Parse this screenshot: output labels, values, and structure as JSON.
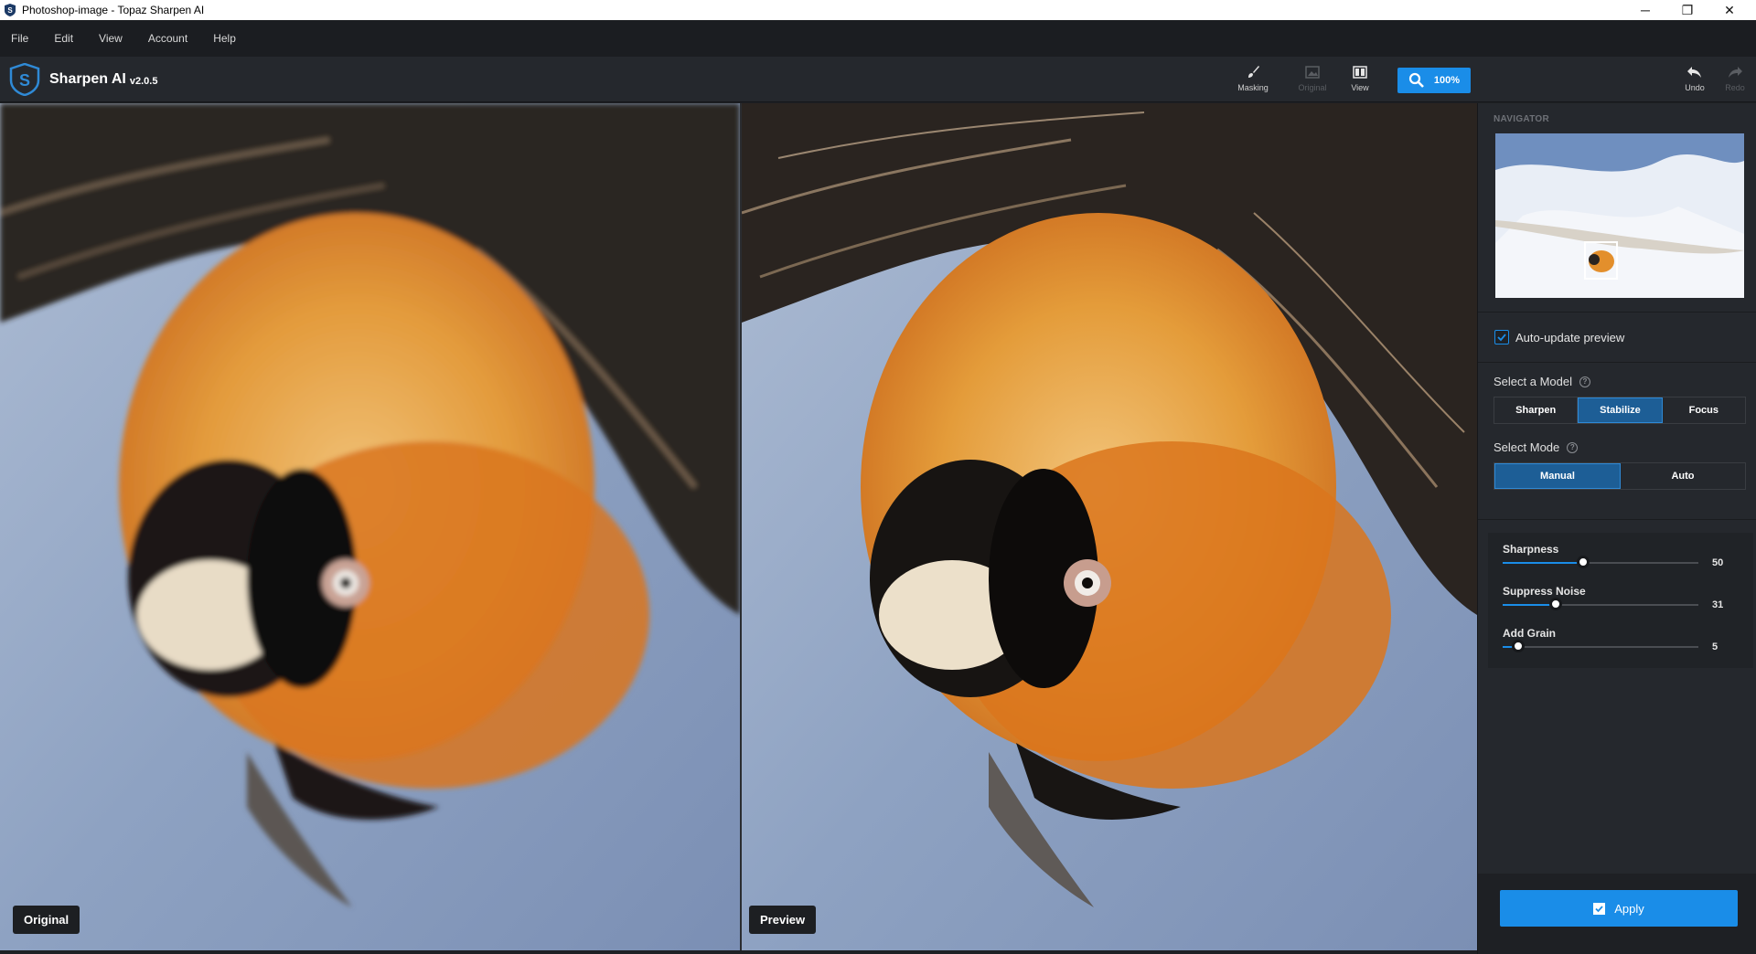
{
  "window": {
    "title": "Photoshop-image - Topaz Sharpen AI",
    "minimize_glyph": "─",
    "restore_glyph": "❐",
    "close_glyph": "✕"
  },
  "menu": {
    "items": [
      {
        "label": "File"
      },
      {
        "label": "Edit"
      },
      {
        "label": "View"
      },
      {
        "label": "Account"
      },
      {
        "label": "Help"
      }
    ]
  },
  "toolbar": {
    "app_name": "Sharpen AI",
    "version": "v2.0.5",
    "masking_label": "Masking",
    "original_label": "Original",
    "view_label": "View",
    "zoom_label": "100%",
    "undo_label": "Undo",
    "redo_label": "Redo"
  },
  "canvas": {
    "left_tag": "Original",
    "right_tag": "Preview"
  },
  "sidebar": {
    "navigator_label": "NAVIGATOR",
    "auto_update": {
      "label": "Auto-update preview",
      "checked": true
    },
    "model": {
      "heading": "Select a Model",
      "help": "?",
      "options": [
        "Sharpen",
        "Stabilize",
        "Focus"
      ],
      "selected": "Stabilize"
    },
    "mode": {
      "heading": "Select Mode",
      "help": "?",
      "options": [
        "Manual",
        "Auto"
      ],
      "selected": "Manual"
    },
    "sliders": [
      {
        "label": "Sharpness",
        "value": "50",
        "fraction": 0.41
      },
      {
        "label": "Suppress Noise",
        "value": "31",
        "fraction": 0.27
      },
      {
        "label": "Add Grain",
        "value": "5",
        "fraction": 0.08
      }
    ],
    "apply_label": "Apply"
  },
  "colors": {
    "accent": "#1a8de8",
    "panel": "#25282d",
    "active_segment": "#1d5e96"
  }
}
